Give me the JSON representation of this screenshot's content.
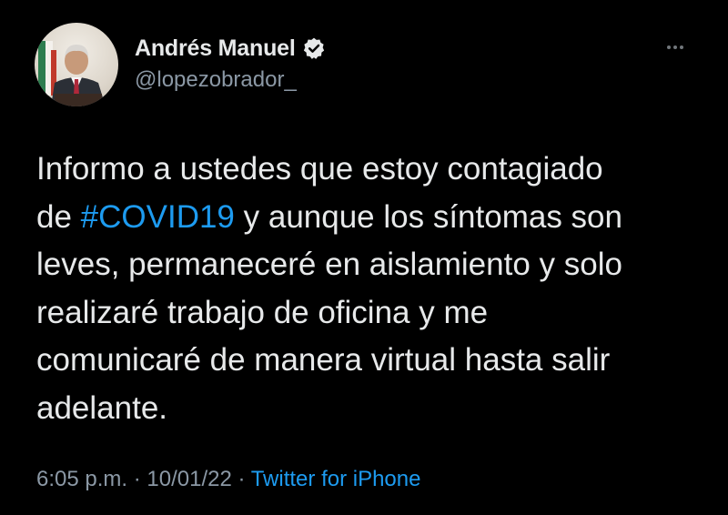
{
  "author": {
    "display_name": "Andrés Manuel",
    "handle": "@lopezobrador_",
    "verified": true,
    "avatar_icon": "profile-photo"
  },
  "more_icon": "more-horizontal-icon",
  "tweet": {
    "lines": [
      {
        "text": "Informo a ustedes que estoy contagiado"
      },
      {
        "prefix": "de ",
        "hashtag": "#COVID19",
        "suffix": " y aunque los síntomas son"
      },
      {
        "text": "leves, permaneceré en aislamiento y solo"
      },
      {
        "text": "realizaré trabajo de oficina y me"
      },
      {
        "text": "comunicaré de manera virtual hasta salir"
      },
      {
        "text": "adelante."
      }
    ]
  },
  "meta": {
    "time": "6:05 p.m.",
    "separator": " · ",
    "date": "10/01/22",
    "source": "Twitter for iPhone"
  },
  "colors": {
    "background": "#000000",
    "text": "#e7e9ea",
    "secondary": "#8b98a5",
    "link": "#1d9bf0"
  }
}
